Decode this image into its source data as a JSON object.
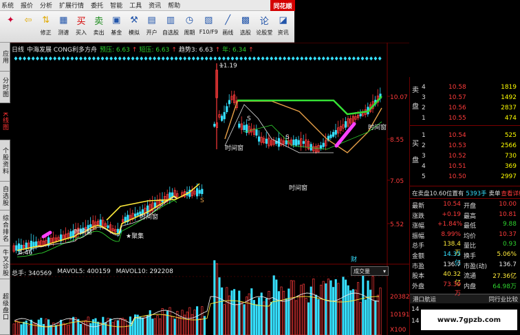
{
  "menu": [
    "系统",
    "报价",
    "分析",
    "扩展行情",
    "委托",
    "智能",
    "工具",
    "资讯",
    "帮助"
  ],
  "brand": "同花顺",
  "toolbar": [
    {
      "label": "",
      "icon": "home-icon"
    },
    {
      "label": "",
      "icon": "back-arrow-icon"
    },
    {
      "label": "修正",
      "icon": "up-down-icon"
    },
    {
      "label": "测谱",
      "icon": "chart-test-icon"
    },
    {
      "label": "买入",
      "icon": "buy-icon"
    },
    {
      "label": "卖出",
      "icon": "sell-icon"
    },
    {
      "label": "基金",
      "icon": "fund-icon"
    },
    {
      "label": "模拟",
      "icon": "gavel-icon"
    },
    {
      "label": "开户",
      "icon": "open-account-icon"
    },
    {
      "label": "自选股",
      "icon": "watchlist-icon"
    },
    {
      "label": "周期",
      "icon": "period-icon"
    },
    {
      "label": "F10/F9",
      "icon": "f10-icon"
    },
    {
      "label": "画线",
      "icon": "draw-line-icon"
    },
    {
      "label": "选股",
      "icon": "stock-select-icon"
    },
    {
      "label": "论股堂",
      "icon": "forum-icon"
    },
    {
      "label": "资讯",
      "icon": "news-icon"
    }
  ],
  "left_tabs": [
    {
      "label": "应用",
      "active": false
    },
    {
      "label": "分时图",
      "active": false
    },
    {
      "label": "K线图",
      "active": true
    },
    {
      "label": "个股资料",
      "active": false
    },
    {
      "label": "自选股",
      "active": false
    },
    {
      "label": "综合排名",
      "active": false
    },
    {
      "label": "牛叉诊股",
      "active": false
    },
    {
      "label": "超级盘口",
      "active": false
    }
  ],
  "chart_header": {
    "period": "日线",
    "title": "中海发展 CONG利多方舟",
    "items": [
      {
        "text": "预压: 6.63",
        "color": "#2fd32f"
      },
      {
        "text": "↑",
        "color": "#ff3b3b"
      },
      {
        "text": "短压: 6.63",
        "color": "#2fd32f"
      },
      {
        "text": "↑",
        "color": "#ff3b3b"
      },
      {
        "text": "趋势3: 6.63",
        "color": "#e8e8e8"
      },
      {
        "text": "↑",
        "color": "#ff3b3b"
      },
      {
        "text": "年: 6.34",
        "color": "#2fd32f"
      },
      {
        "text": "↑",
        "color": "#ff3b3b"
      }
    ]
  },
  "chart_data": {
    "type": "candlestick",
    "price_axis_ticks": [
      "10.07",
      "8.55",
      "7.05",
      "5.52"
    ],
    "annotations": [
      "11.19",
      "4.46",
      "时间窗",
      "时间窗",
      "时间窗",
      "时间窗",
      "时间窗",
      "★聚集",
      "B",
      "S",
      "S",
      "S",
      "财"
    ],
    "volume_axis_ticks": [
      "20382",
      "10191",
      "X100"
    ],
    "colors": {
      "up": "#ff3b3b",
      "down": "#36e0ff",
      "ma1": "#ffeb3b",
      "ma2": "#2fd32f",
      "ma3": "#e8e8e8",
      "ma4": "#e8a048",
      "highlight": "#ff40ff"
    }
  },
  "volume_header": {
    "total": "总手: 340569",
    "mavol5": "MAVOL5: 400159",
    "mavol10": "MAVOL10: 292208",
    "dropdown": "成交量"
  },
  "orderbook": {
    "sell": [
      {
        "level": "4",
        "price": "10.58",
        "vol": "1819"
      },
      {
        "level": "3",
        "price": "10.57",
        "vol": "1492"
      },
      {
        "level": "2",
        "price": "10.56",
        "vol": "2837"
      },
      {
        "level": "1",
        "price": "10.55",
        "vol": "474"
      }
    ],
    "buy": [
      {
        "level": "1",
        "price": "10.54",
        "vol": "525"
      },
      {
        "level": "2",
        "price": "10.53",
        "vol": "2566"
      },
      {
        "level": "3",
        "price": "10.52",
        "vol": "730"
      },
      {
        "level": "4",
        "price": "10.51",
        "vol": "369"
      },
      {
        "level": "5",
        "price": "10.50",
        "vol": "2997"
      }
    ],
    "sell_label": "卖盘",
    "buy_label": "买盘"
  },
  "position_line": {
    "text": "在卖盘10.60位置有",
    "qty": "5393手",
    "sell_word": "卖单",
    "detail": "查看详细"
  },
  "quote": [
    {
      "k1": "最新",
      "v1": "10.54",
      "c1": "#ff3b3b",
      "k2": "开盘",
      "v2": "10.00",
      "c2": "#ff3b3b"
    },
    {
      "k1": "涨跌",
      "v1": "+0.19",
      "c1": "#ff3b3b",
      "k2": "最高",
      "v2": "10.81",
      "c2": "#ff3b3b"
    },
    {
      "k1": "涨幅",
      "v1": "+1.84%",
      "c1": "#ff3b3b",
      "k2": "最低",
      "v2": "9.88",
      "c2": "#2fd32f"
    },
    {
      "k1": "振幅",
      "v1": "8.99%",
      "c1": "#ff3b3b",
      "k2": "均价",
      "v2": "10.37",
      "c2": "#ff3b3b"
    },
    {
      "k1": "总手",
      "v1": "138.4万",
      "c1": "#ffeb3b",
      "k2": "量比",
      "v2": "0.93",
      "c2": "#2fd32f"
    },
    {
      "k1": "金额",
      "v1": "14.35亿",
      "c1": "#36e0ff",
      "k2": "换手",
      "v2": "5.06%",
      "c2": "#ffeb3b"
    },
    {
      "k1": "市盈",
      "v1": "136.7",
      "c1": "#e8e8e8",
      "k2": "市盈(动)",
      "v2": "136.7",
      "c2": "#e8e8e8"
    },
    {
      "k1": "股本",
      "v1": "40.32亿",
      "c1": "#ffeb3b",
      "k2": "流通",
      "v2": "27.36亿",
      "c2": "#ffeb3b"
    },
    {
      "k1": "外盘",
      "v1": "73.39万",
      "c1": "#ff3b3b",
      "k2": "内盘",
      "v2": "64.98万",
      "c2": "#2fd32f"
    }
  ],
  "bottom_tabs": {
    "left": "港口航运",
    "right": "同行业比较"
  },
  "tick_rows": [
    "14",
    "14"
  ],
  "watermark": "www.7gpzb.com"
}
